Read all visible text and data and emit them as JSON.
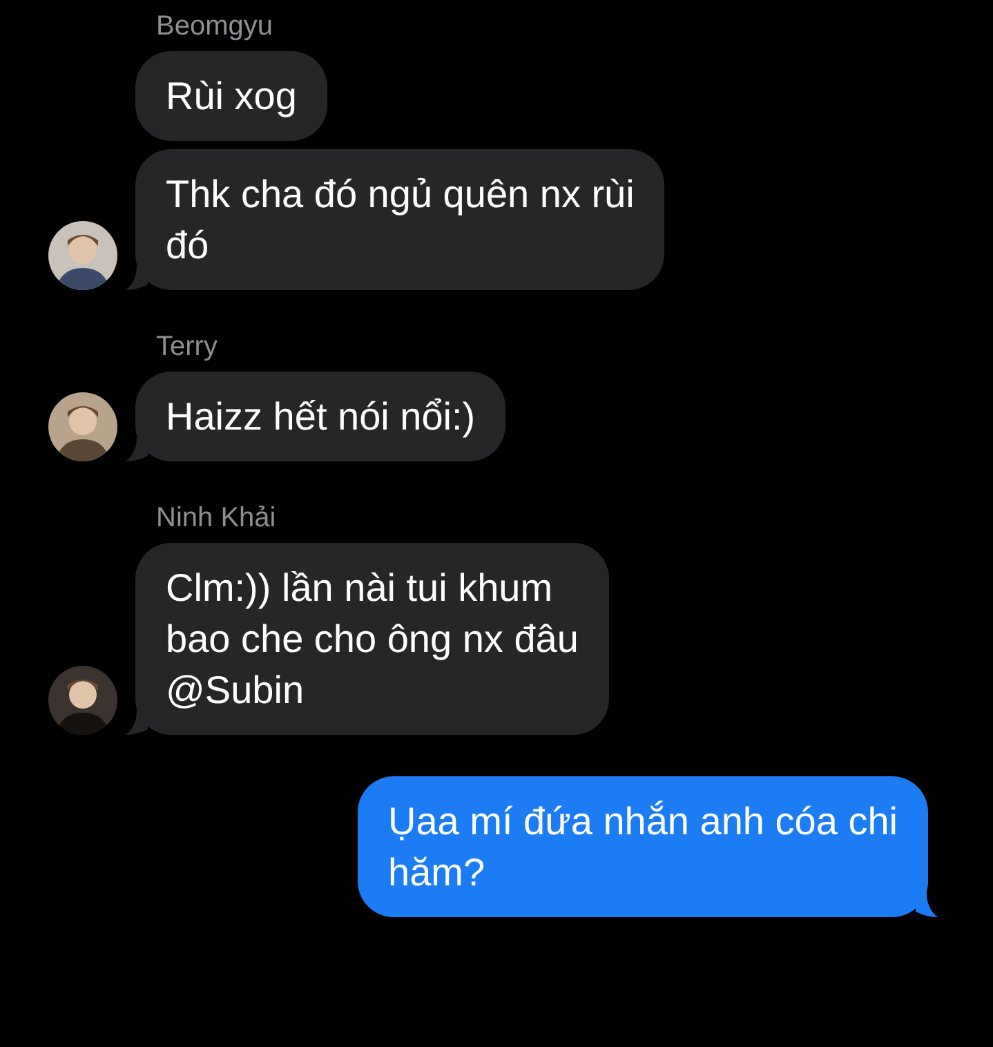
{
  "groups": [
    {
      "sender": "Beomgyu",
      "avatar": {
        "kind": "picture"
      },
      "messages": [
        "Rùi xog",
        "Thk cha đó ngủ quên nx rùi\nđó"
      ]
    },
    {
      "sender": "Terry",
      "avatar": {
        "kind": "picture"
      },
      "messages": [
        "Haizz hết nói nổi:)"
      ]
    },
    {
      "sender": "Ninh  Khải",
      "avatar": {
        "kind": "picture"
      },
      "messages": [
        "Clm:)) lần nài tui khum\nbao che cho ông nx đâu\n@Subin"
      ]
    }
  ],
  "outgoing": [
    "Ụaa mí đứa nhắn anh cóa chi\nhăm?"
  ]
}
